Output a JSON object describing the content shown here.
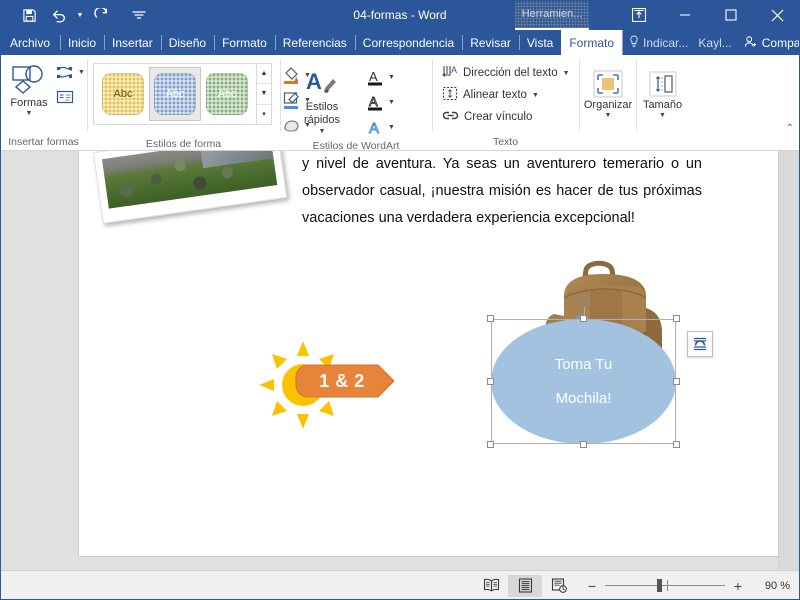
{
  "window": {
    "title": "04-formas  -  Word",
    "contextual_tab": "Herramien...",
    "quick_access": [
      {
        "name": "save-icon",
        "label": "Guardar"
      },
      {
        "name": "undo-icon",
        "label": "Deshacer"
      },
      {
        "name": "redo-icon",
        "label": "Rehacer"
      },
      {
        "name": "customize-qat-icon",
        "label": "Personalizar barra de herramientas de acceso rápido"
      }
    ],
    "controls": [
      {
        "name": "ribbon-display-options-icon",
        "label": "Opciones de presentación de la cinta"
      },
      {
        "name": "minimize-icon",
        "label": "Minimizar"
      },
      {
        "name": "maximize-icon",
        "label": "Maximizar"
      },
      {
        "name": "close-icon",
        "label": "Cerrar"
      }
    ]
  },
  "tabs": [
    {
      "label": "Archivo",
      "active": false
    },
    {
      "label": "Inicio",
      "active": false
    },
    {
      "label": "Insertar",
      "active": false
    },
    {
      "label": "Diseño",
      "active": false
    },
    {
      "label": "Formato",
      "active": false
    },
    {
      "label": "Referencias",
      "active": false
    },
    {
      "label": "Correspondencia",
      "active": false
    },
    {
      "label": "Revisar",
      "active": false
    },
    {
      "label": "Vista",
      "active": false
    },
    {
      "label": "Formato",
      "active": true
    }
  ],
  "tabstrip_right": {
    "tell_me": "Indicar...",
    "user": "Kayl...",
    "share": "Compartir"
  },
  "ribbon": {
    "groups": [
      {
        "name": "insertar-formas",
        "label": "Insertar formas",
        "buttons": [
          {
            "name": "formas-button",
            "label": "Formas",
            "icon": "shapes-icon"
          },
          {
            "name": "editar-forma-button",
            "label": "Editar forma",
            "icon": "edit-shape-icon"
          },
          {
            "name": "cuadro-texto-button",
            "label": "Cuadro de texto",
            "icon": "text-box-icon"
          }
        ]
      },
      {
        "name": "estilos-de-forma",
        "label": "Estilos de forma",
        "gallery": [
          {
            "name": "style-thumb-yellow",
            "text": "Abc",
            "color": "#e8c34a",
            "selected": false
          },
          {
            "name": "style-thumb-blue",
            "text": "Abc",
            "color": "#7f9fcb",
            "selected": true
          },
          {
            "name": "style-thumb-green",
            "text": "Abc",
            "color": "#87b07c",
            "selected": false
          }
        ],
        "side_buttons": [
          {
            "name": "relleno-de-forma-button",
            "label": "Relleno de forma",
            "accent": "#e8761e"
          },
          {
            "name": "contorno-de-forma-button",
            "label": "Contorno de forma",
            "accent": "#4a90d9"
          },
          {
            "name": "efectos-de-forma-button",
            "label": "Efectos de forma"
          }
        ]
      },
      {
        "name": "estilos-de-wordart",
        "label": "Estilos de WordArt",
        "buttons": [
          {
            "name": "estilos-rapidos-button",
            "label": "Estilos rápidos",
            "icon": "wordart-quick-styles-icon"
          },
          {
            "name": "relleno-de-texto-button",
            "label": "Relleno de texto"
          },
          {
            "name": "contorno-de-texto-button",
            "label": "Contorno de texto"
          },
          {
            "name": "efectos-de-texto-button",
            "label": "Efectos de texto"
          }
        ]
      },
      {
        "name": "texto",
        "label": "Texto",
        "items": [
          {
            "name": "direccion-del-texto-button",
            "label": "Dirección del texto",
            "has_caret": true
          },
          {
            "name": "alinear-texto-button",
            "label": "Alinear texto",
            "has_caret": true
          },
          {
            "name": "crear-vinculo-button",
            "label": "Crear vínculo",
            "has_caret": false
          }
        ]
      },
      {
        "name": "organizar",
        "label": "Organizar",
        "buttons": [
          {
            "name": "organizar-button",
            "label": "Organizar",
            "icon": "arrange-icon"
          }
        ]
      },
      {
        "name": "tamano",
        "label": "Tamaño",
        "buttons": [
          {
            "name": "tamano-button",
            "label": "Tamaño",
            "icon": "size-icon"
          }
        ]
      }
    ]
  },
  "document": {
    "paragraph": "y nivel de aventura. Ya seas un aventurero temerario o un observador casual, ¡nuestra misión es hacer de tus próximas vacaciones una verdadera experiencia excepcional!",
    "shapes": {
      "sun": {
        "name": "sun-shape",
        "color": "#fcc200"
      },
      "banner": {
        "name": "arrow-banner-shape",
        "text": "1 & 2",
        "color": "#e8833a",
        "text_color": "#ffffff"
      },
      "ellipse": {
        "name": "ellipse-shape",
        "line1": "Toma Tu",
        "line2": "Mochila!",
        "fill": "#a3c2e0",
        "text_color": "#ffffff",
        "selected": true
      },
      "backpack": {
        "name": "backpack-image",
        "alt": "Mochila"
      },
      "photo": {
        "name": "photo-image",
        "alt": "Fotografía de personas en el césped"
      }
    },
    "layout_options_button": {
      "name": "layout-options-button",
      "label": "Opciones de diseño"
    }
  },
  "status_bar": {
    "views": [
      {
        "name": "read-mode-button",
        "label": "Modo de lectura",
        "active": false
      },
      {
        "name": "print-layout-button",
        "label": "Diseño de impresión",
        "active": true
      },
      {
        "name": "web-layout-button",
        "label": "Diseño web",
        "active": false
      }
    ],
    "zoom_out": "−",
    "zoom_in": "+",
    "zoom_level": "90 %"
  }
}
